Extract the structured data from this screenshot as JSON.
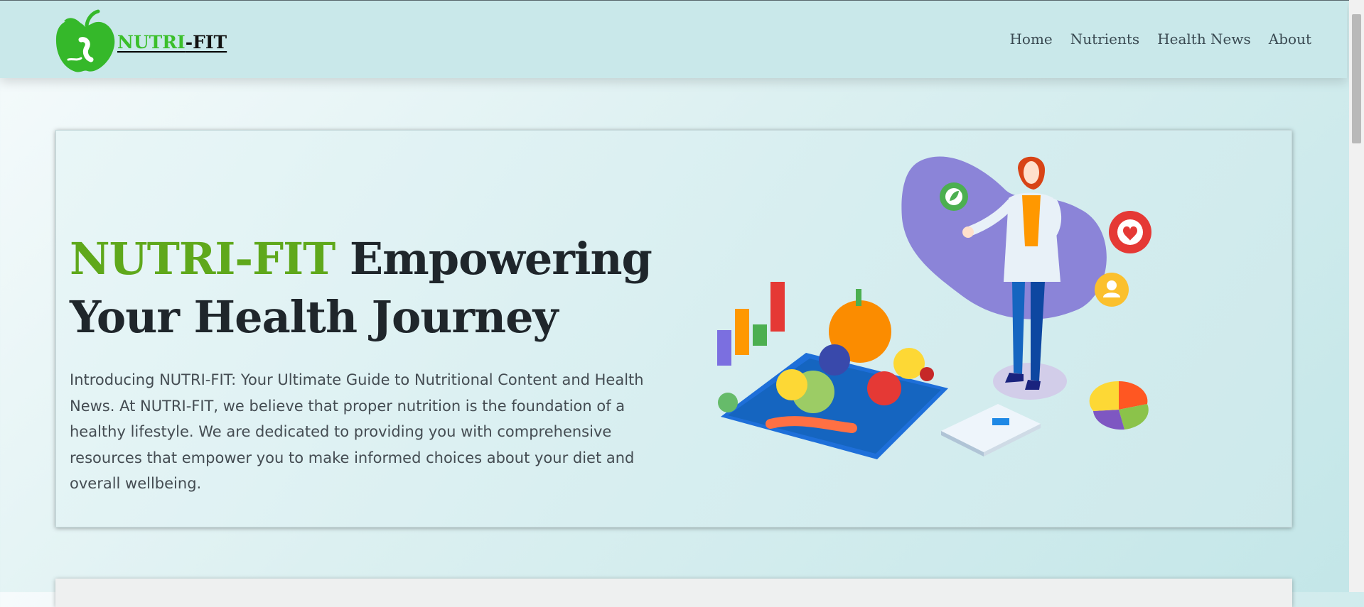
{
  "brand": {
    "part1": "NUTRI",
    "part2": "-FIT"
  },
  "nav": {
    "items": [
      "Home",
      "Nutrients",
      "Health News",
      "About"
    ]
  },
  "hero": {
    "title_brand": "NUTRI-FIT",
    "title_rest": " Empowering Your Health Journey",
    "description": "Introducing NUTRI-FIT: Your Ultimate Guide to Nutritional Content and Health News. At NUTRI-FIT, we believe that proper nutrition is the foundation of a healthy lifestyle. We are dedicated to providing you with comprehensive resources that empower you to make informed choices about your diet and overall wellbeing."
  },
  "icons": {
    "logo": "apple-logo-icon",
    "illustration": "doctor-nutrition-illustration"
  },
  "colors": {
    "brand_green": "#3bbf2b",
    "title_green": "#5fa81b",
    "navbar_bg": "#c9e8ea"
  }
}
